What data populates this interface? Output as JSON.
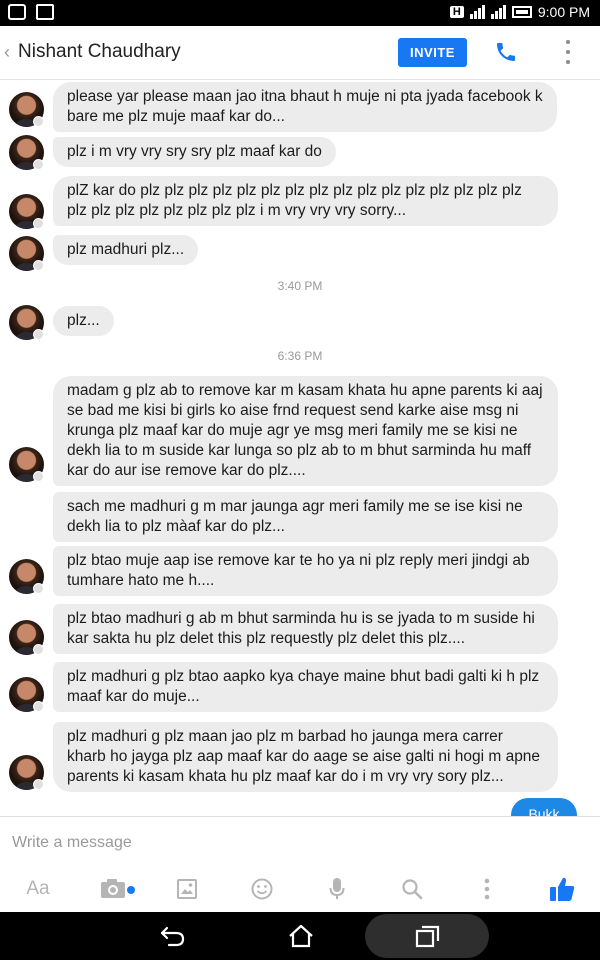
{
  "status_bar": {
    "time": "9:00 PM",
    "h_indicator": "H"
  },
  "header": {
    "back_glyph": "‹",
    "title": "Nishant Chaudhary",
    "invite_label": "INVITE",
    "call_icon": "phone-icon",
    "more_icon": "more-vertical-icon"
  },
  "messages": [
    {
      "text": "please yar please maan jao itna bhaut h muje ni pta jyada facebook k bare me plz muje maaf kar do..."
    },
    {
      "text": "plz i m vry vry sry sry plz  maaf kar do"
    },
    {
      "text": "plZ kar do plz plz plz plz plz plz plz plz plz plz plz plz plz plz plz plz plz plz plz plz plz plz plz plz i m vry vry vry sorry..."
    },
    {
      "text": "plz madhuri plz..."
    },
    {
      "text": "plz..."
    },
    {
      "text": "madam g plz ab to remove kar m kasam khata hu apne parents ki aaj se bad me kisi bi girls ko aise frnd request send karke aise msg ni krunga plz maaf kar do muje agr ye msg meri family me se kisi ne dekh lia to m suside kar lunga so plz ab to m bhut sarminda hu maff kar do aur ise remove kar do plz...."
    },
    {
      "text": "sach me madhuri g m mar jaunga agr meri family me se ise kisi ne dekh lia to plz màaf kar do plz..."
    },
    {
      "text": "plz btao muje aap ise remove kar te ho ya ni plz reply meri jindgi ab tumhare hato me h...."
    },
    {
      "text": "plz btao madhuri g ab m bhut sarminda hu is se jyada to m suside hi kar sakta hu plz delet this plz requestly plz delet this plz...."
    },
    {
      "text": "plz madhuri g plz btao aapko kya chaye maine bhut badi galti ki h plz maaf kar do muje..."
    },
    {
      "text": "plz madhuri g plz maan jao plz m barbad ho jaunga mera carrer kharb ho jayga plz aap maaf kar do aage se aise galti ni hogi m apne parents ki kasam khata hu plz maaf kar do i m vry vry sory plz..."
    }
  ],
  "timestamps": [
    "3:40 PM",
    "6:36 PM"
  ],
  "sent_partial": "Bukk",
  "composer": {
    "placeholder": "Write a message",
    "toolbar": [
      {
        "label": "Aa",
        "icon": "text-format-icon"
      },
      {
        "icon": "camera-icon"
      },
      {
        "icon": "gallery-icon"
      },
      {
        "icon": "emoji-icon"
      },
      {
        "icon": "microphone-icon"
      },
      {
        "icon": "search-icon"
      },
      {
        "icon": "more-vertical-icon"
      },
      {
        "icon": "thumbs-up-icon"
      }
    ]
  },
  "nav_bar": {
    "icons": [
      "back-icon",
      "home-icon",
      "recent-apps-icon"
    ]
  },
  "colors": {
    "accent": "#1877f2",
    "bubble_bg": "#ececec",
    "sent_bubble": "#1e88e5",
    "status_bar": "#000000"
  }
}
